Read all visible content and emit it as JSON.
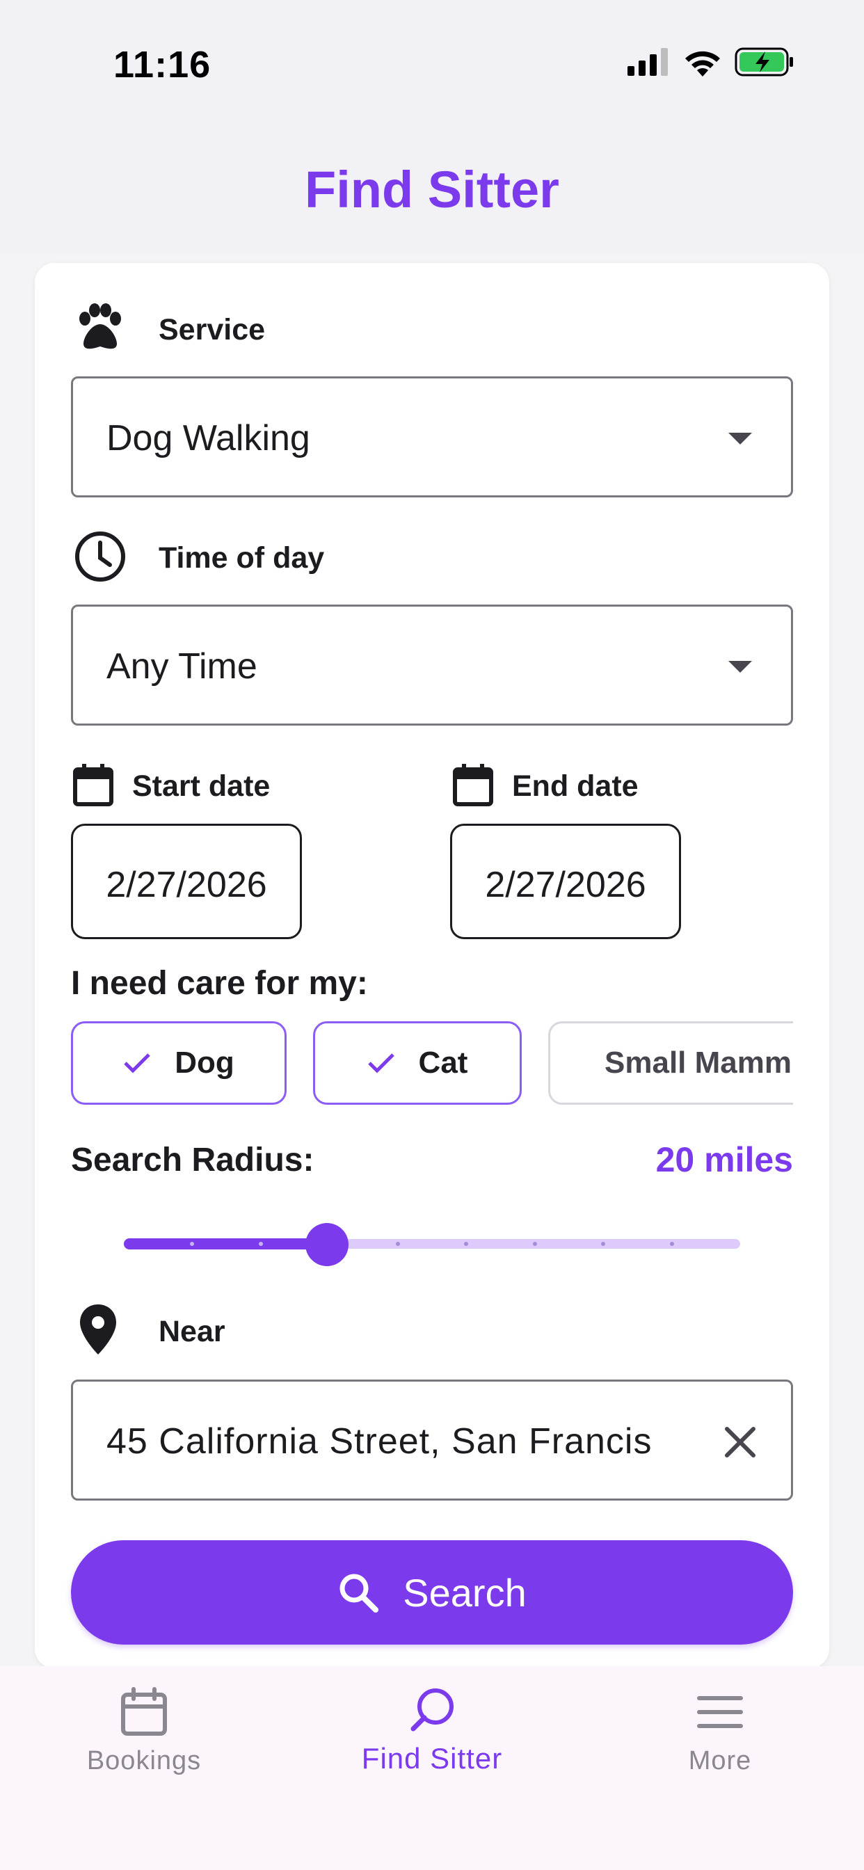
{
  "status_bar": {
    "time": "11:16"
  },
  "header": {
    "title": "Find Sitter"
  },
  "form": {
    "service": {
      "label": "Service",
      "value": "Dog Walking"
    },
    "time_of_day": {
      "label": "Time of day",
      "value": "Any Time"
    },
    "start_date": {
      "label": "Start date",
      "value": "2/27/2026"
    },
    "end_date": {
      "label": "End date",
      "value": "2/27/2026"
    },
    "care_for": {
      "label": "I need care for my:",
      "chips": [
        {
          "label": "Dog",
          "selected": true
        },
        {
          "label": "Cat",
          "selected": true
        },
        {
          "label": "Small Mamm",
          "selected": false
        }
      ]
    },
    "radius": {
      "label": "Search Radius:",
      "value_text": "20 miles",
      "slider_fraction": 0.33
    },
    "near": {
      "label": "Near",
      "value": "45 California Street, San Francis"
    },
    "search_button": "Search"
  },
  "bottom_nav": {
    "items": [
      {
        "label": "Bookings",
        "icon": "calendar-icon"
      },
      {
        "label": "Find Sitter",
        "icon": "search-icon"
      },
      {
        "label": "More",
        "icon": "menu-icon"
      }
    ],
    "active": "Find Sitter"
  },
  "colors": {
    "accent": "#7c3aed",
    "accent_light": "#dccbfb",
    "nav_bg": "#fcf5fc"
  }
}
